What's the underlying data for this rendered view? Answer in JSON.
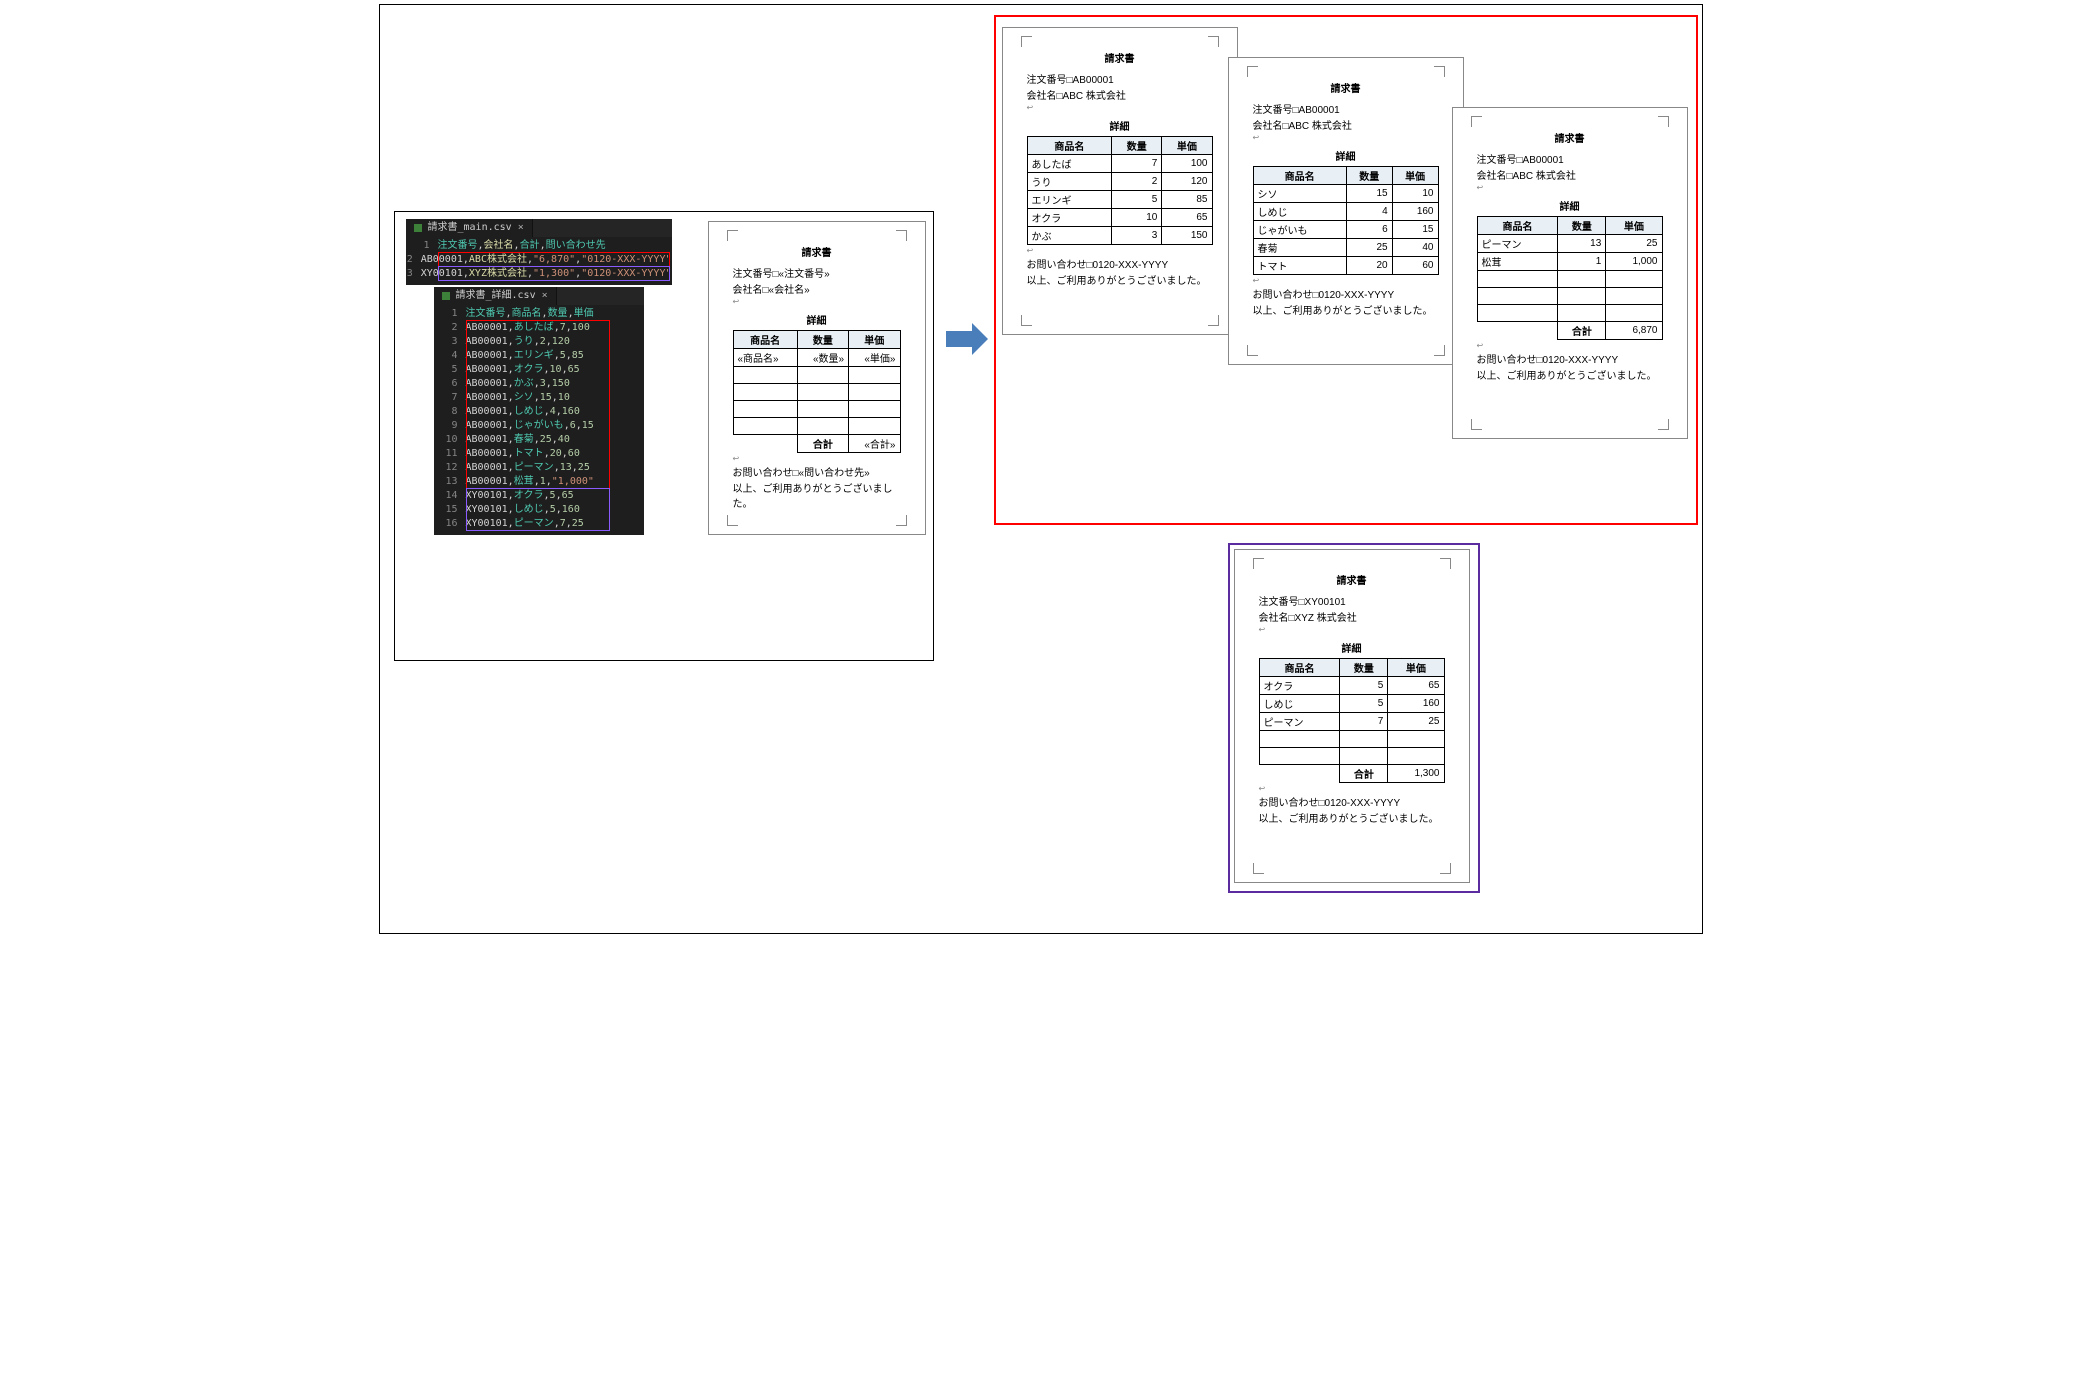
{
  "editor_main": {
    "filename": "請求書_main.csv",
    "close": "×",
    "lines": [
      {
        "n": "1",
        "text": "注文番号,会社名,合計,問い合わせ先",
        "cls": [
          "tok-def",
          "tok-key",
          "tok-def",
          "tok-key"
        ]
      },
      {
        "n": "2",
        "text": "AB00001,ABC株式会社,\"6,870\",\"0120-XXX-YYYY\"",
        "cls": [
          "tok-id",
          "tok-org",
          "tok-str",
          "tok-str"
        ]
      },
      {
        "n": "3",
        "text": "XY00101,XYZ株式会社,\"1,300\",\"0120-XXX-YYYY\"",
        "cls": [
          "tok-id",
          "tok-org",
          "tok-str",
          "tok-str"
        ]
      }
    ]
  },
  "editor_detail": {
    "filename": "請求書_詳細.csv",
    "close": "×",
    "lines": [
      {
        "n": "1",
        "text": "注文番号,商品名,数量,単価"
      },
      {
        "n": "2",
        "text": "AB00001,あしたば,7,100"
      },
      {
        "n": "3",
        "text": "AB00001,うり,2,120"
      },
      {
        "n": "4",
        "text": "AB00001,エリンギ,5,85"
      },
      {
        "n": "5",
        "text": "AB00001,オクラ,10,65"
      },
      {
        "n": "6",
        "text": "AB00001,かぶ,3,150"
      },
      {
        "n": "7",
        "text": "AB00001,シソ,15,10"
      },
      {
        "n": "8",
        "text": "AB00001,しめじ,4,160"
      },
      {
        "n": "9",
        "text": "AB00001,じゃがいも,6,15"
      },
      {
        "n": "10",
        "text": "AB00001,春菊,25,40"
      },
      {
        "n": "11",
        "text": "AB00001,トマト,20,60"
      },
      {
        "n": "12",
        "text": "AB00001,ピーマン,13,25"
      },
      {
        "n": "13",
        "text": "AB00001,松茸,1,\"1,000\""
      },
      {
        "n": "14",
        "text": "XY00101,オクラ,5,65"
      },
      {
        "n": "15",
        "text": "XY00101,しめじ,5,160"
      },
      {
        "n": "16",
        "text": "XY00101,ピーマン,7,25"
      }
    ]
  },
  "template": {
    "title": "請求書",
    "order": "注文番号□«注文番号»",
    "company": "会社名□«会社名»",
    "sub": "詳細",
    "headers": [
      "商品名",
      "数量",
      "単価"
    ],
    "ph": [
      "«商品名»",
      "«数量»",
      "«単価»"
    ],
    "total_label": "合計",
    "total_ph": "«合計»",
    "contact": "お問い合わせ□«問い合わせ先»",
    "closing": "以上、ご利用ありがとうございました。"
  },
  "docA1": {
    "title": "請求書",
    "order": "注文番号□AB00001",
    "company": "会社名□ABC 株式会社",
    "sub": "詳細",
    "headers": [
      "商品名",
      "数量",
      "単価"
    ],
    "rows": [
      [
        "あしたば",
        "7",
        "100"
      ],
      [
        "うり",
        "2",
        "120"
      ],
      [
        "エリンギ",
        "5",
        "85"
      ],
      [
        "オクラ",
        "10",
        "65"
      ],
      [
        "かぶ",
        "3",
        "150"
      ]
    ],
    "contact": "お問い合わせ□0120-XXX-YYYY",
    "closing": "以上、ご利用ありがとうございました。"
  },
  "docA2": {
    "title": "請求書",
    "order": "注文番号□AB00001",
    "company": "会社名□ABC 株式会社",
    "sub": "詳細",
    "headers": [
      "商品名",
      "数量",
      "単価"
    ],
    "rows": [
      [
        "シソ",
        "15",
        "10"
      ],
      [
        "しめじ",
        "4",
        "160"
      ],
      [
        "じゃがいも",
        "6",
        "15"
      ],
      [
        "春菊",
        "25",
        "40"
      ],
      [
        "トマト",
        "20",
        "60"
      ]
    ],
    "contact": "お問い合わせ□0120-XXX-YYYY",
    "closing": "以上、ご利用ありがとうございました。"
  },
  "docA3": {
    "title": "請求書",
    "order": "注文番号□AB00001",
    "company": "会社名□ABC 株式会社",
    "sub": "詳細",
    "headers": [
      "商品名",
      "数量",
      "単価"
    ],
    "rows": [
      [
        "ピーマン",
        "13",
        "25"
      ],
      [
        "松茸",
        "1",
        "1,000"
      ],
      [
        "",
        "",
        ""
      ],
      [
        "",
        "",
        ""
      ],
      [
        "",
        "",
        ""
      ]
    ],
    "total_label": "合計",
    "total_value": "6,870",
    "contact": "お問い合わせ□0120-XXX-YYYY",
    "closing": "以上、ご利用ありがとうございました。"
  },
  "docB": {
    "title": "請求書",
    "order": "注文番号□XY00101",
    "company": "会社名□XYZ 株式会社",
    "sub": "詳細",
    "headers": [
      "商品名",
      "数量",
      "単価"
    ],
    "rows": [
      [
        "オクラ",
        "5",
        "65"
      ],
      [
        "しめじ",
        "5",
        "160"
      ],
      [
        "ピーマン",
        "7",
        "25"
      ],
      [
        "",
        "",
        ""
      ],
      [
        "",
        "",
        ""
      ]
    ],
    "total_label": "合計",
    "total_value": "1,300",
    "contact": "お問い合わせ□0120-XXX-YYYY",
    "closing": "以上、ご利用ありがとうございました。"
  }
}
